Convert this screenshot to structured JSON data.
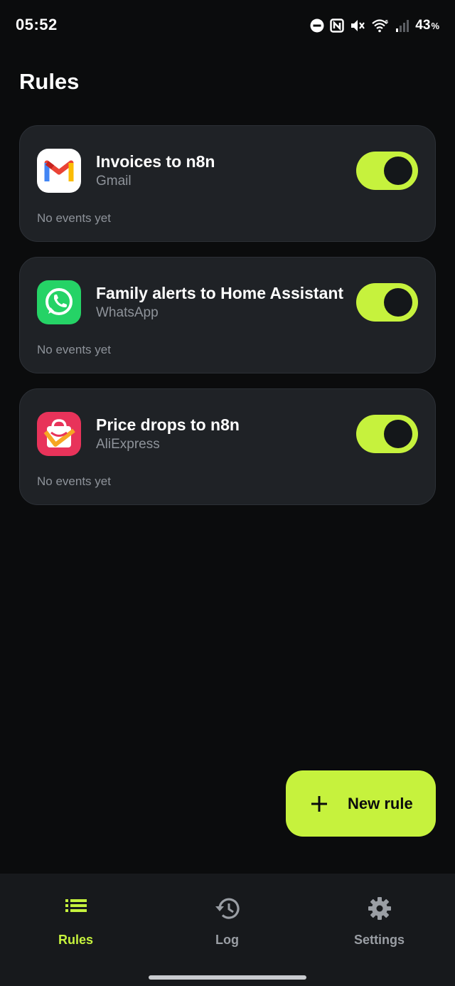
{
  "status_bar": {
    "time": "05:52",
    "battery_percent": "43",
    "battery_symbol": "%"
  },
  "page": {
    "title": "Rules"
  },
  "rules": [
    {
      "name": "Invoices to n8n",
      "app": "Gmail",
      "events": "No events yet",
      "enabled": true,
      "icon": "gmail-icon"
    },
    {
      "name": "Family alerts to Home Assistant",
      "app": "WhatsApp",
      "events": "No events yet",
      "enabled": true,
      "icon": "whatsapp-icon"
    },
    {
      "name": "Price drops to n8n",
      "app": "AliExpress",
      "events": "No events yet",
      "enabled": true,
      "icon": "aliexpress-icon"
    }
  ],
  "fab": {
    "label": "New rule",
    "icon": "plus-icon"
  },
  "nav": {
    "items": [
      {
        "label": "Rules",
        "icon": "list-icon",
        "active": true
      },
      {
        "label": "Log",
        "icon": "history-icon",
        "active": false
      },
      {
        "label": "Settings",
        "icon": "gear-icon",
        "active": false
      }
    ]
  },
  "colors": {
    "accent": "#c6f23d",
    "background": "#0b0c0d",
    "card": "#1f2226",
    "secondary_text": "#8e939a"
  }
}
